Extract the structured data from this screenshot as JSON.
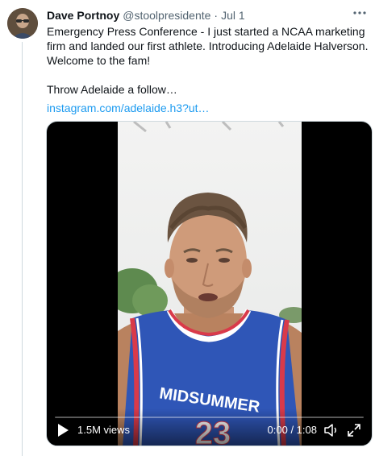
{
  "tweet": {
    "author_name": "Dave Portnoy",
    "author_handle": "@stoolpresidente",
    "separator": "·",
    "date": "Jul 1",
    "text": "Emergency Press Conference - I just started a NCAA marketing firm and landed our first athlete.  Introducing Adelaide Halverson. Welcome to the fam!\n\nThrow Adelaide a follow…",
    "link": "instagram.com/adelaide.h3?ut…",
    "more_icon": "more-horizontal-icon"
  },
  "video": {
    "views": "1.5M views",
    "time": "0:00 / 1:08",
    "progress": 0,
    "jersey_text": "MIDSUMMER",
    "icons": {
      "play": "play-icon",
      "volume": "volume-icon",
      "fullscreen": "fullscreen-icon"
    }
  },
  "colors": {
    "link": "#1d9bf0",
    "secondary_text": "#536471",
    "divider": "#cfd9de"
  }
}
